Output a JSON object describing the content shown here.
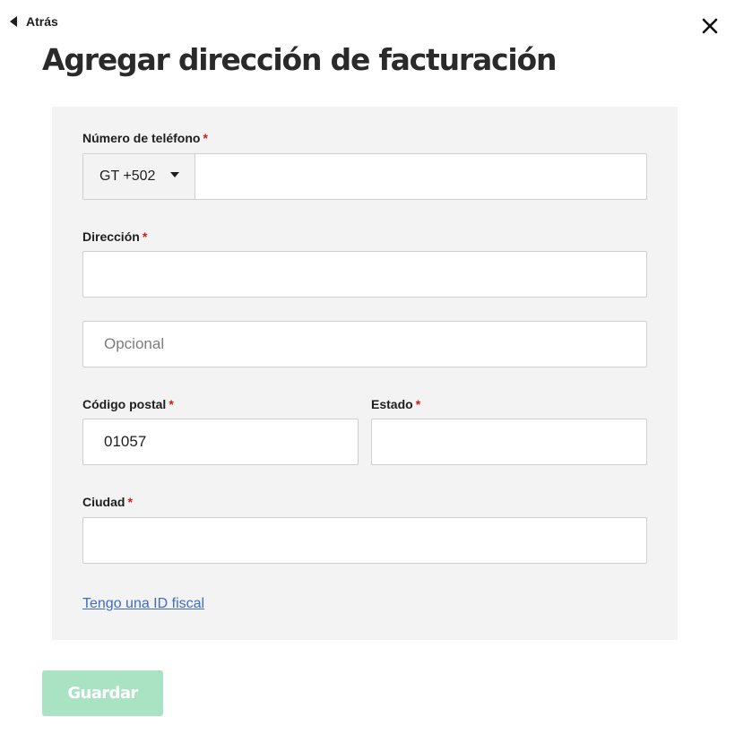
{
  "header": {
    "back_label": "Atrás",
    "title": "Agregar dirección de facturación"
  },
  "form": {
    "required_mark": "*",
    "phone": {
      "label": "Número de teléfono",
      "country_code": "GT +502",
      "value": ""
    },
    "address": {
      "label": "Dirección",
      "value": ""
    },
    "address2": {
      "placeholder": "Opcional",
      "value": ""
    },
    "postal_code": {
      "label": "Código postal",
      "value": "01057"
    },
    "state": {
      "label": "Estado",
      "value": ""
    },
    "city": {
      "label": "Ciudad",
      "value": ""
    },
    "tax_id_link": "Tengo una ID fiscal"
  },
  "footer": {
    "save_label": "Guardar"
  },
  "icons": {
    "back": "caret-left-icon",
    "close": "close-icon",
    "dropdown": "caret-down-icon"
  },
  "colors": {
    "required": "#d21a1a",
    "link": "#3f6bc4",
    "save_button_disabled": "#a9e3c3",
    "panel_background": "#f3f3f3"
  }
}
